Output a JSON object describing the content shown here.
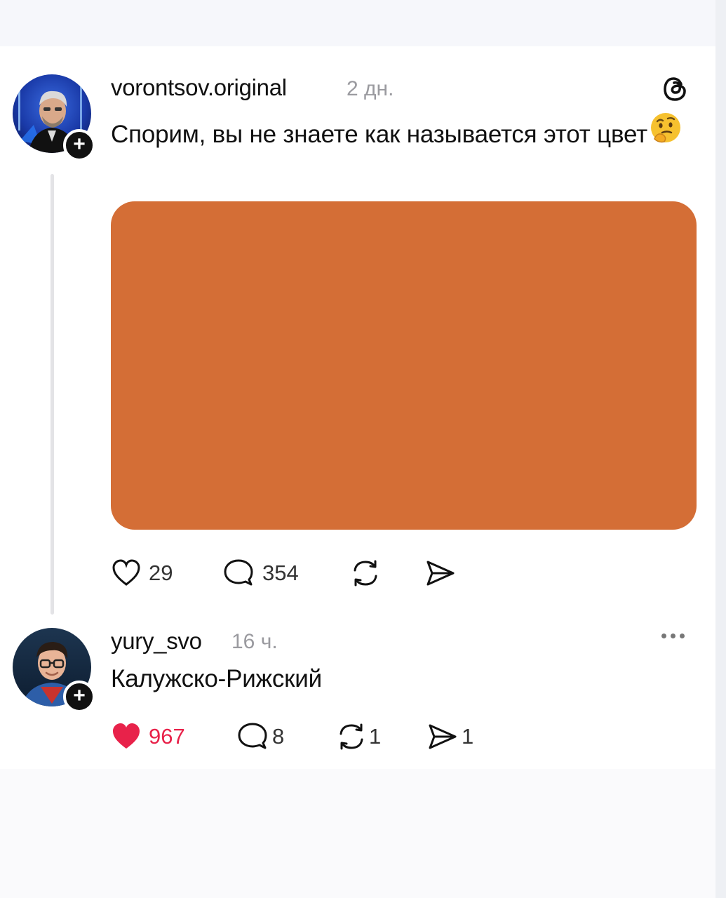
{
  "post": {
    "username": "vorontsov.original",
    "time": "2 дн.",
    "text": "Спорим, вы не знаете как называется этот цвет",
    "emoji": "thinking-face-emoji",
    "media_color": "#d46e36",
    "actions": {
      "likes": "29",
      "comments": "354"
    }
  },
  "reply": {
    "username": "yury_svo",
    "time": "16 ч.",
    "text": "Калужско-Рижский",
    "actions": {
      "likes": "967",
      "comments": "8",
      "reposts": "1",
      "shares": "1"
    }
  },
  "icons": {
    "app": "threads-icon",
    "like": "heart-icon",
    "comment": "comment-icon",
    "repost": "repost-icon",
    "share": "send-icon",
    "more": "more-icon",
    "follow": "plus-icon"
  },
  "colors": {
    "like_active": "#e8224a",
    "badge": "#111111"
  }
}
